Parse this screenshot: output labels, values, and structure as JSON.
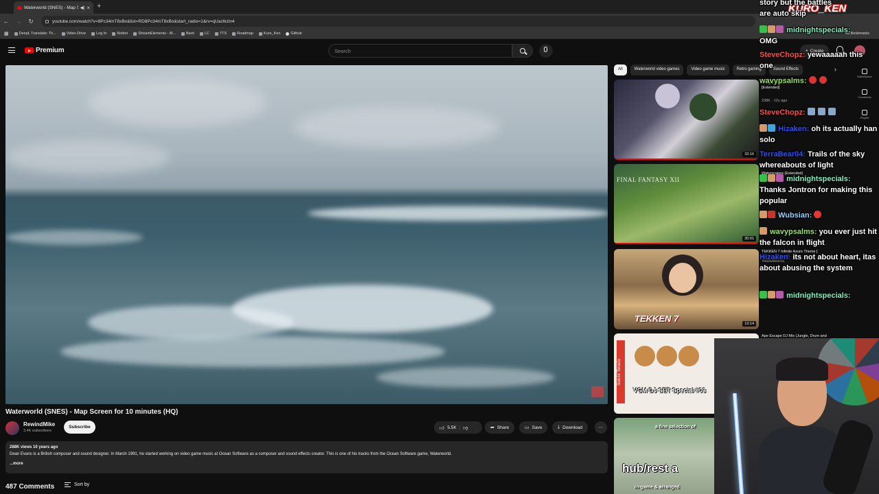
{
  "browser": {
    "tab_title": "Waterworld (SNES) - Map S",
    "url": "youtube.com/watch?v=8Pc34mT8xBo&list=RD8Pc34mT8xBo&start_radio=1&rv=qUazIkzin4",
    "bookmarks": [
      "DeepL Translate: Th...",
      "Video Drive",
      "Log In",
      "Notion",
      "StreamElements - M...",
      "Bard",
      "LC",
      "TTS",
      "Roadmap",
      "Kuro_Ken",
      "Github"
    ],
    "all_bookmarks": "All Bookmarks"
  },
  "header": {
    "logo": "Premium",
    "search_placeholder": "Search",
    "create_label": "Create"
  },
  "video": {
    "title": "Waterworld (SNES) - Map Screen for 10 minutes (HQ)",
    "channel": "RewindMike",
    "subscribers": "3.4K subscribers",
    "subscribe_label": "Subscribe",
    "likes": "5.5K",
    "share_label": "Share",
    "save_label": "Save",
    "download_label": "Download",
    "views_date": "288K views  10 years ago",
    "description": "Dean Evans is a British composer and sound designer. In March 1991, he started working on video game music at Ocean Software as a composer and sound effects creator. This is one of his tracks from the Ocean Software game, Waterworld.",
    "more_label": "...more",
    "comments_count": "487 Comments",
    "sort_label": "Sort by"
  },
  "chips": [
    "All",
    "Waterworld video games",
    "Video game music",
    "Retro gaming",
    "Sound Effects"
  ],
  "recommendations": [
    {
      "duration": "33:16",
      "title_lines": [
        "Danganronpa",
        "[Extended]"
      ],
      "meta": "238K · 12y ago"
    },
    {
      "duration": "30:01",
      "title_lines": [
        "Waterscapes (Extended)"
      ],
      "meta": ""
    },
    {
      "duration": "13:14",
      "title_lines": [
        "TEKKEN 7 Infinite Azure Theme [",
        "Tekken 7 Music]",
        "YellowMetroX"
      ],
      "meta": ""
    },
    {
      "duration": "",
      "title_lines": [
        "Ape Escape DJ Mix (Jungle, Drum and"
      ],
      "meta": ""
    },
    {
      "duration": "",
      "title_lines": [],
      "meta": ""
    }
  ],
  "thumb_text": {
    "ffxii": "FINAL FANTASY XII",
    "tekken": "TEKKEN 7",
    "vgm": "VGM DJ SET Special #03",
    "vgm_side": "Soichi Terada",
    "hub_top": "a fine selection of",
    "hub_main": "hub/rest a",
    "hub_bot": "in-game & arranged"
  },
  "side_actions": [
    "Subscription",
    "Comments",
    "Playlist"
  ],
  "chat": {
    "streamer_tag": "KURO_KEN",
    "lines": [
      {
        "user": "",
        "text": "story but the battles are auto skip"
      },
      {
        "user": "midnightspecials:",
        "text": "OMG"
      },
      {
        "user": "SteveChopz:",
        "text": "yewaaaaah this one"
      },
      {
        "user": "wavypsalms:",
        "text": ""
      },
      {
        "user": "SteveChopz:",
        "text": ""
      },
      {
        "user": "Hizaken:",
        "text": "oh its actually han solo"
      },
      {
        "user": "TerraBear04:",
        "text": "Trails of the sky whereabouts of light"
      },
      {
        "user": "midnightspecials:",
        "text": "Thanks Jontron for making this popular"
      },
      {
        "user": "Wubsian:",
        "text": ""
      },
      {
        "user": "wavypsalms:",
        "text": "you ever just hit the falcon in flight"
      },
      {
        "user": "Hizaken:",
        "text": "its not about heart, itas about abusing the system"
      },
      {
        "user": "midnightspecials:",
        "text": ""
      }
    ]
  },
  "colors": {
    "accent_red": "#ff0000",
    "chat_green": "#7cf2c0",
    "chat_red": "#ff4d4d",
    "chat_blue": "#2850ff"
  }
}
